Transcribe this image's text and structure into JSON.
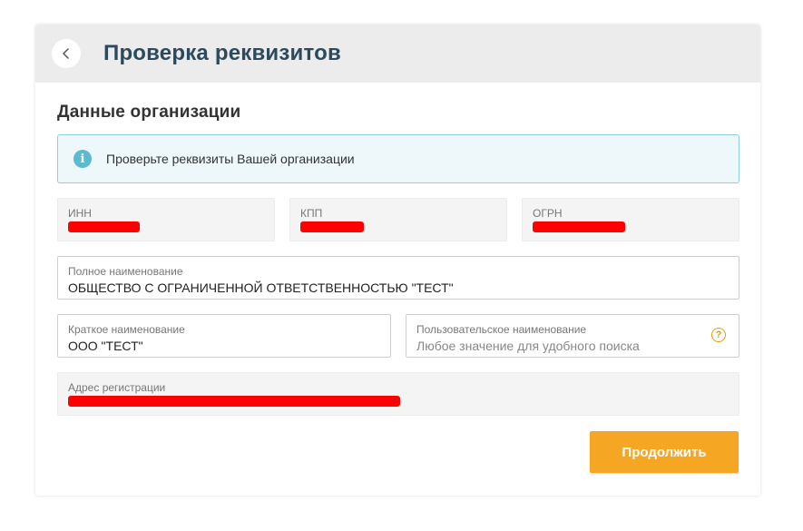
{
  "header": {
    "title": "Проверка реквизитов",
    "back_icon": "chevron-left-icon"
  },
  "section": {
    "title": "Данные организации"
  },
  "info": {
    "icon": "info-icon",
    "icon_glyph": "i",
    "text": "Проверьте реквизиты Вашей организации"
  },
  "fields": {
    "inn": {
      "label": "ИНН",
      "redacted": true
    },
    "kpp": {
      "label": "КПП",
      "redacted": true
    },
    "ogrn": {
      "label": "ОГРН",
      "redacted": true
    },
    "full_name": {
      "label": "Полное наименование",
      "value": "ОБЩЕСТВО С ОГРАНИЧЕННОЙ ОТВЕТСТВЕННОСТЬЮ \"ТЕСТ\""
    },
    "short_name": {
      "label": "Краткое наименование",
      "value": "ООО \"ТЕСТ\""
    },
    "custom_name": {
      "label": "Пользовательское наименование",
      "placeholder": "Любое значение для удобного поиска",
      "help_glyph": "?"
    },
    "address": {
      "label": "Адрес регистрации",
      "redacted": true
    }
  },
  "actions": {
    "continue_label": "Продолжить"
  },
  "colors": {
    "accent": "#f5a623",
    "title": "#2b4a5d",
    "info_border": "#8fd0dc",
    "info_bg": "#eef8fa",
    "redaction": "#ff0000"
  }
}
